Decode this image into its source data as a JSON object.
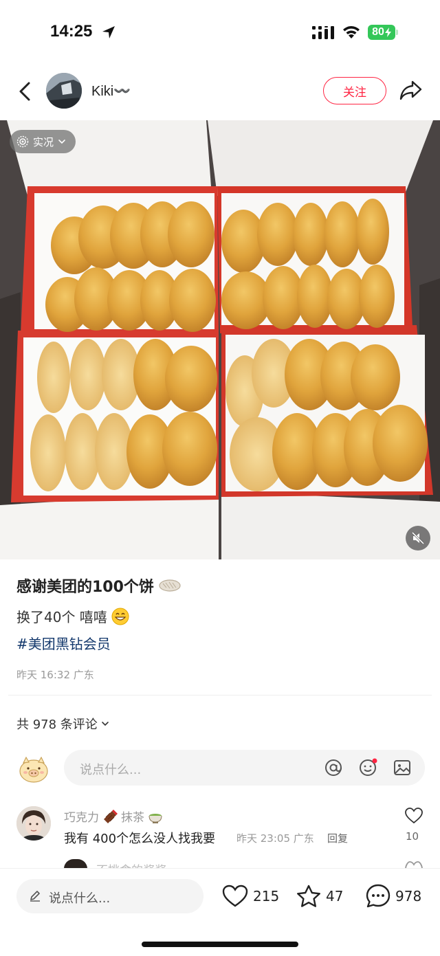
{
  "status_bar": {
    "time": "14:25",
    "battery": "80"
  },
  "header": {
    "username": "Kiki〰️",
    "follow_label": "关注"
  },
  "photo": {
    "live_label": "实况"
  },
  "post": {
    "title": "感谢美团的100个饼",
    "body": "换了40个 嘻嘻",
    "hashtag": "#美团黑钻会员",
    "meta": "昨天 16:32 广东"
  },
  "comments": {
    "count_label": "共 978 条评论",
    "input_placeholder": "说点什么...",
    "items": [
      {
        "user": "巧克力",
        "user_suffix": "抹茶",
        "text": "我有 400个怎么没人找我要",
        "meta": "昨天 23:05 广东",
        "reply_label": "回复",
        "likes": "10"
      },
      {
        "user": "不挑食的酱酱"
      }
    ]
  },
  "bottom_bar": {
    "input_placeholder": "说点什么...",
    "likes": "215",
    "favorites": "47",
    "comments": "978"
  },
  "colors": {
    "accent": "#ff2442",
    "hashtag": "#13386c",
    "battery": "#34c759"
  }
}
